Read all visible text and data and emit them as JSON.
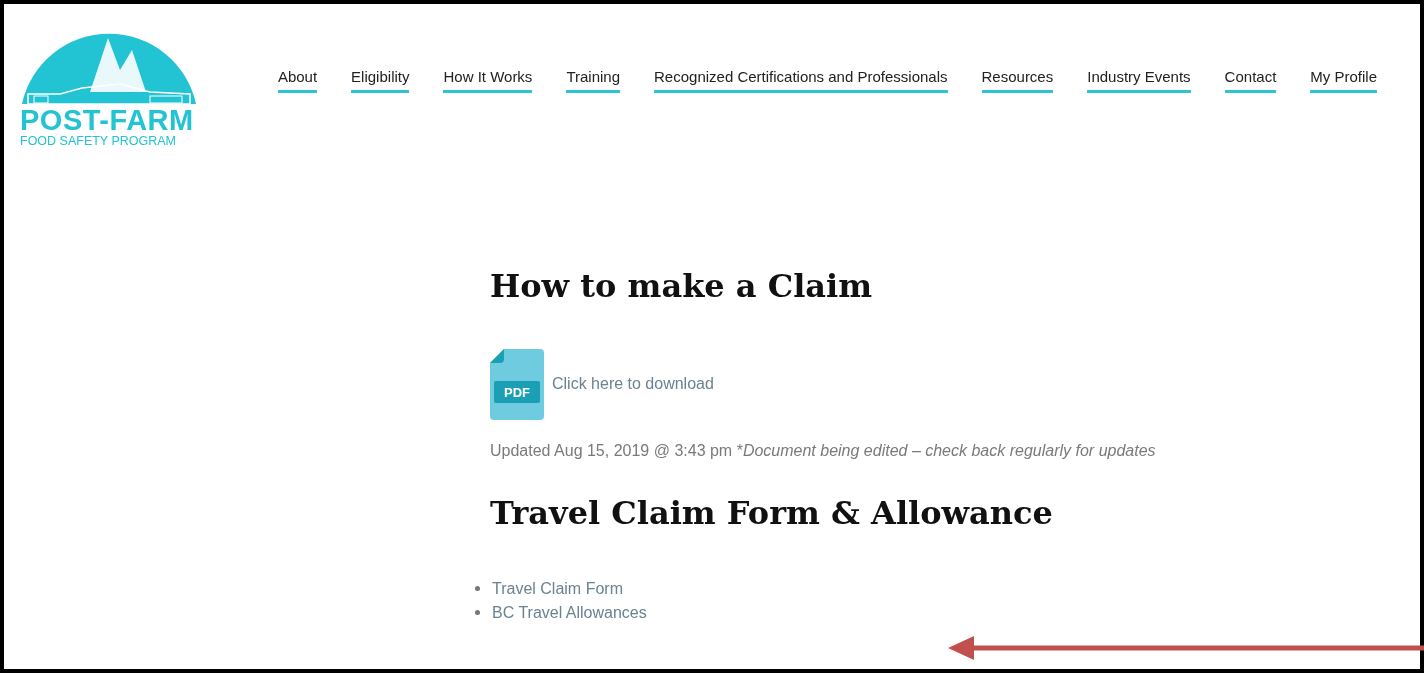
{
  "logo": {
    "title": "POST-FARM",
    "subtitle": "FOOD SAFETY PROGRAM"
  },
  "nav": [
    {
      "label": "About"
    },
    {
      "label": "Eligibility"
    },
    {
      "label": "How It Works"
    },
    {
      "label": "Training"
    },
    {
      "label": "Recognized Certifications and Professionals"
    },
    {
      "label": "Resources"
    },
    {
      "label": "Industry Events"
    },
    {
      "label": "Contact"
    },
    {
      "label": "My Profile"
    }
  ],
  "content": {
    "heading": "How to make a Claim",
    "download": {
      "icon_label": "PDF",
      "link": "Click here to download"
    },
    "updated": "Updated Aug 15, 2019 @ 3:43 pm *",
    "note": "Document being edited – check back regularly for updates",
    "heading2": "Travel Claim Form & Allowance",
    "links": [
      "Travel Claim Form",
      "BC Travel Allowances"
    ]
  }
}
